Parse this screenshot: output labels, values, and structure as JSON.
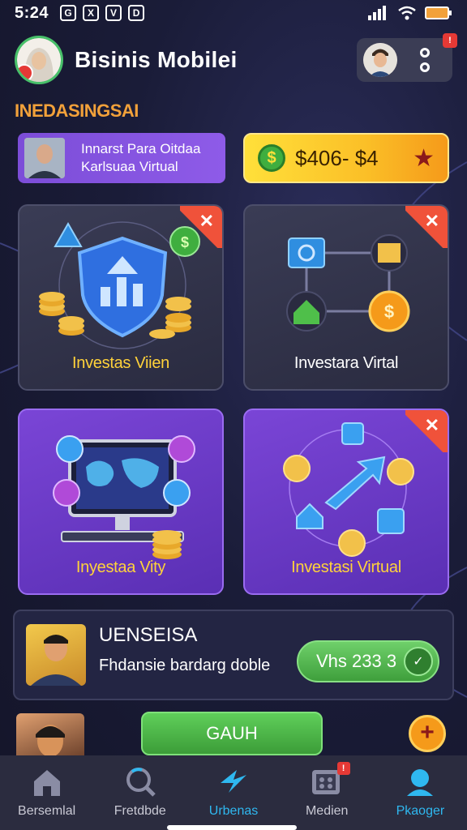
{
  "status_bar": {
    "time": "5:24",
    "icons_left": [
      "G",
      "X",
      "V",
      "D"
    ]
  },
  "header": {
    "app_title": "Bisinis Mobilei",
    "notification_badge": "!"
  },
  "section_label": "INEDASINGSAI",
  "banner_left": {
    "line1": "Innarst Para Oitdaa",
    "line2": "Karlsuaa Virtual"
  },
  "banner_right": {
    "coin_symbol": "$",
    "amount": "$406- $4",
    "star_icon": "★"
  },
  "cards": [
    {
      "title": "Investas Viien",
      "close": "✕"
    },
    {
      "title": "Investara Virtal",
      "close": "✕"
    },
    {
      "title": "Inyestaa Vity"
    },
    {
      "title": "Investasi Virtual",
      "close": "✕"
    }
  ],
  "promo": {
    "title": "UENSEISA",
    "subtitle": "Fhdansie bardarg doble",
    "button_label": "Vhs 233 3"
  },
  "row2": {
    "button_label": "GAUH",
    "add_symbol": "+"
  },
  "bottom_nav": [
    {
      "label": "Bersemlal",
      "icon": "home-icon"
    },
    {
      "label": "Fretdbde",
      "icon": "search-icon"
    },
    {
      "label": "Urbenas",
      "icon": "lightning-icon",
      "active": true
    },
    {
      "label": "Medien",
      "icon": "media-icon",
      "badge": "!"
    },
    {
      "label": "Pkaoger",
      "icon": "profile-icon"
    }
  ],
  "colors": {
    "accent_cyan": "#2fb8f0",
    "gold": "#ffd23a",
    "purple": "#7a45d6",
    "green": "#4fbf4a"
  }
}
